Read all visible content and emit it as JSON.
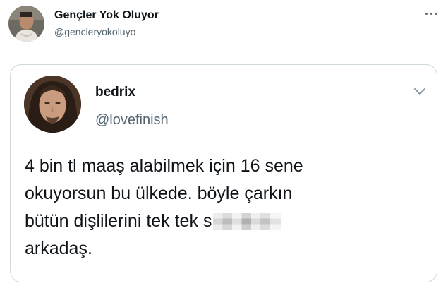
{
  "outer_tweet": {
    "display_name": "Gençler Yok Oluyor",
    "handle": "@gencleryokoluyo",
    "avatar_icon": "profile-photo-icon",
    "more_icon": "more-options-icon"
  },
  "quoted_tweet": {
    "display_name": "bedrix",
    "handle": "@lovefinish",
    "avatar_icon": "profile-photo-icon",
    "menu_icon": "chevron-down-icon",
    "text_lines": [
      "4 bin tl maaş alabilmek için 16 sene",
      "okuyorsun bu ülkede. böyle çarkın",
      "bütün dişlilerini tek tek s",
      "arkadaş."
    ]
  },
  "colors": {
    "text_primary": "#0f1419",
    "text_secondary": "#536471",
    "border": "#cfd9de",
    "background": "#ffffff"
  }
}
